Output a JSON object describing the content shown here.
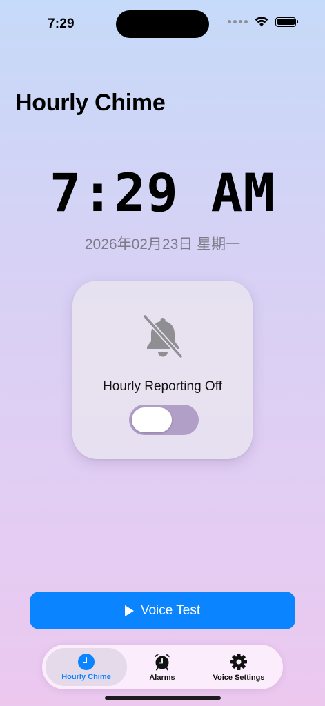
{
  "status_bar": {
    "time": "7:29"
  },
  "app": {
    "title": "Hourly Chime"
  },
  "clock": {
    "time": "7:29 AM",
    "date": "2026年02月23日 星期一"
  },
  "chime_card": {
    "icon": "bell-slash-icon",
    "label": "Hourly Reporting Off",
    "toggle_on": false
  },
  "actions": {
    "voice_test_label": "Voice Test"
  },
  "tabbar": {
    "tabs": [
      {
        "label": "Hourly Chime",
        "icon": "clock-icon",
        "active": true
      },
      {
        "label": "Alarms",
        "icon": "alarm-clock-icon",
        "active": false
      },
      {
        "label": "Voice Settings",
        "icon": "gear-icon",
        "active": false
      }
    ]
  },
  "colors": {
    "accent": "#0a84ff",
    "toggle_track": "#b19fc8"
  }
}
